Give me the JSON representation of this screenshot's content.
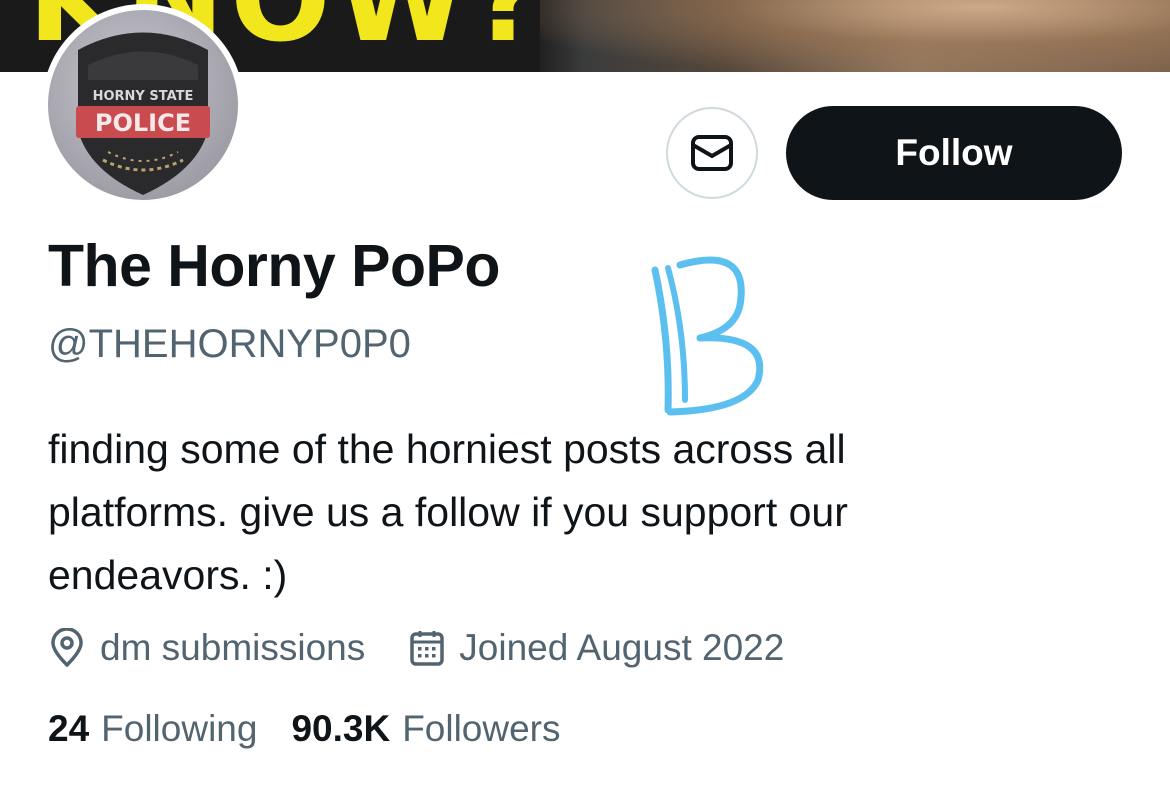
{
  "banner": {
    "text": "KNOW?"
  },
  "avatar": {
    "badge_top": "HORNY STATE",
    "badge_main": "POLICE"
  },
  "actions": {
    "message_icon": "mail-icon",
    "follow_label": "Follow"
  },
  "profile": {
    "name": "The Horny PoPo",
    "handle": "@THEHORNYP0P0",
    "bio": "finding some of the horniest posts across all platforms. give us a follow if you support our endeavors. :)"
  },
  "meta": {
    "location_icon": "location-pin-icon",
    "location": "dm submissions",
    "joined_icon": "calendar-icon",
    "joined": "Joined August 2022"
  },
  "stats": {
    "following_count": "24",
    "following_label": "Following",
    "followers_count": "90.3K",
    "followers_label": "Followers"
  },
  "colors": {
    "text_primary": "#0f1419",
    "text_secondary": "#536471",
    "button_dark": "#0f1419",
    "banner_yellow": "#f2e61d",
    "scribble": "#5bc0f0"
  }
}
